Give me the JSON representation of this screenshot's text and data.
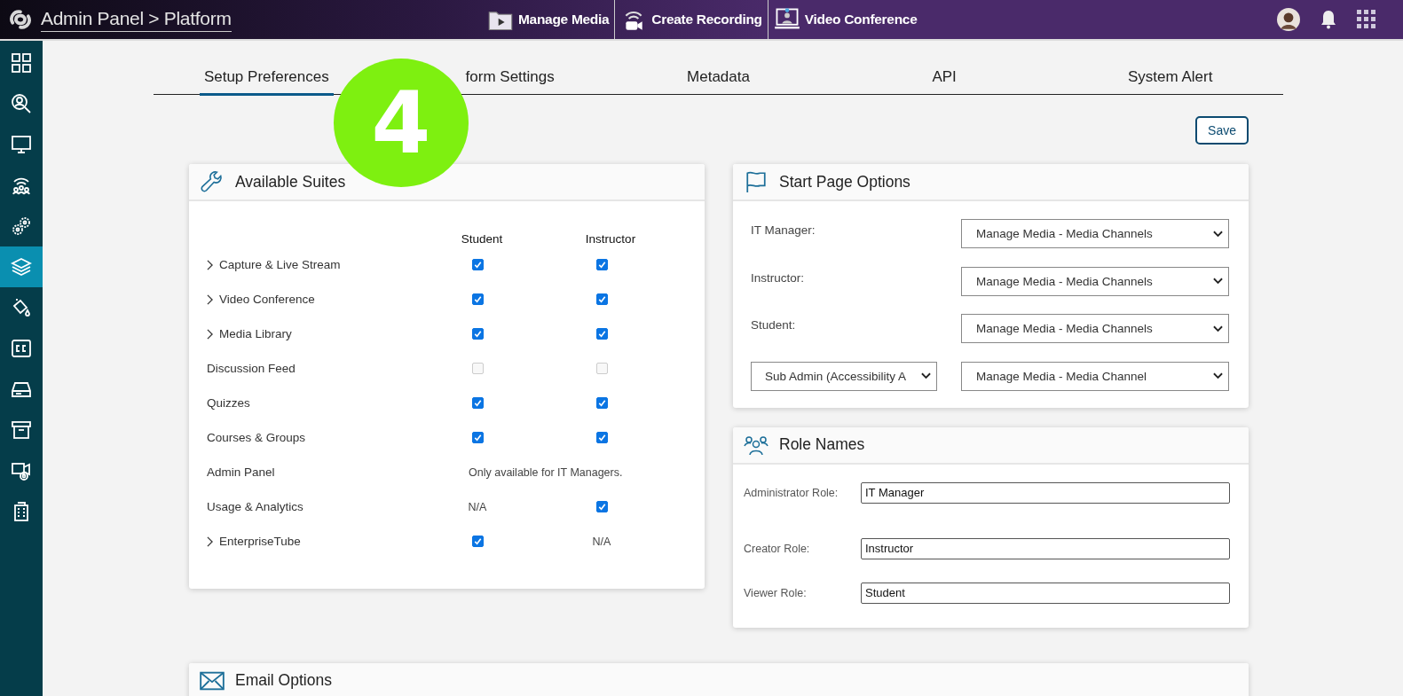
{
  "topbar": {
    "title": "Admin Panel > Platform",
    "nav": [
      {
        "label": "Manage Media"
      },
      {
        "label": "Create Recording"
      },
      {
        "label": "Video Conference"
      }
    ]
  },
  "sidebar": {
    "items": [
      {
        "selected": false
      },
      {
        "selected": false
      },
      {
        "selected": false
      },
      {
        "selected": false
      },
      {
        "selected": false
      },
      {
        "selected": true
      },
      {
        "selected": false
      },
      {
        "selected": false
      },
      {
        "selected": false
      },
      {
        "selected": false
      },
      {
        "selected": false
      },
      {
        "selected": false
      }
    ]
  },
  "tabs": [
    {
      "label": "Setup Preferences",
      "selected": true
    },
    {
      "label": "form Settings",
      "selected": false
    },
    {
      "label": "Metadata",
      "selected": false
    },
    {
      "label": "API",
      "selected": false
    },
    {
      "label": "System Alert",
      "selected": false
    }
  ],
  "step_marker": "4",
  "save_button": "Save",
  "available_suites": {
    "title": "Available Suites",
    "columns": [
      "Student",
      "Instructor"
    ],
    "rows": [
      {
        "name": "Capture & Live Stream",
        "expandable": true,
        "cells": [
          {
            "kind": "checkbox",
            "checked": true,
            "disabled": false
          },
          {
            "kind": "checkbox",
            "checked": true,
            "disabled": false
          }
        ]
      },
      {
        "name": "Video Conference",
        "expandable": true,
        "cells": [
          {
            "kind": "checkbox",
            "checked": true,
            "disabled": false
          },
          {
            "kind": "checkbox",
            "checked": true,
            "disabled": false
          }
        ]
      },
      {
        "name": "Media Library",
        "expandable": true,
        "cells": [
          {
            "kind": "checkbox",
            "checked": true,
            "disabled": false
          },
          {
            "kind": "checkbox",
            "checked": true,
            "disabled": false
          }
        ]
      },
      {
        "name": "Discussion Feed",
        "expandable": false,
        "cells": [
          {
            "kind": "checkbox",
            "checked": false,
            "disabled": true
          },
          {
            "kind": "checkbox",
            "checked": false,
            "disabled": true
          }
        ]
      },
      {
        "name": "Quizzes",
        "expandable": false,
        "cells": [
          {
            "kind": "checkbox",
            "checked": true,
            "disabled": false
          },
          {
            "kind": "checkbox",
            "checked": true,
            "disabled": false
          }
        ]
      },
      {
        "name": "Courses & Groups",
        "expandable": false,
        "cells": [
          {
            "kind": "checkbox",
            "checked": true,
            "disabled": false
          },
          {
            "kind": "checkbox",
            "checked": true,
            "disabled": false
          }
        ]
      },
      {
        "name": "Admin Panel",
        "expandable": false,
        "note": "Only available for IT Managers."
      },
      {
        "name": "Usage & Analytics",
        "expandable": false,
        "cells": [
          {
            "kind": "text",
            "text": "N/A"
          },
          {
            "kind": "checkbox",
            "checked": true,
            "disabled": false
          }
        ]
      },
      {
        "name": "EnterpriseTube",
        "expandable": true,
        "cells": [
          {
            "kind": "checkbox",
            "checked": true,
            "disabled": false
          },
          {
            "kind": "text",
            "text": "N/A"
          }
        ]
      }
    ]
  },
  "start_page_options": {
    "title": "Start Page Options",
    "rows": [
      {
        "label": "IT Manager:",
        "value": "Manage Media - Media Channels"
      },
      {
        "label": "Instructor:",
        "value": "Manage Media - Media Channels"
      },
      {
        "label": "Student:",
        "value": "Manage Media - Media Channels"
      },
      {
        "role_select": "Sub Admin (Accessibility A",
        "value": "Manage Media - Media Channel"
      }
    ]
  },
  "role_names": {
    "title": "Role Names",
    "fields": [
      {
        "label": "Administrator Role:",
        "value": "IT Manager"
      },
      {
        "label": "Creator Role:",
        "value": "Instructor"
      },
      {
        "label": "Viewer Role:",
        "value": "Student"
      }
    ]
  },
  "email_options": {
    "title": "Email Options"
  }
}
